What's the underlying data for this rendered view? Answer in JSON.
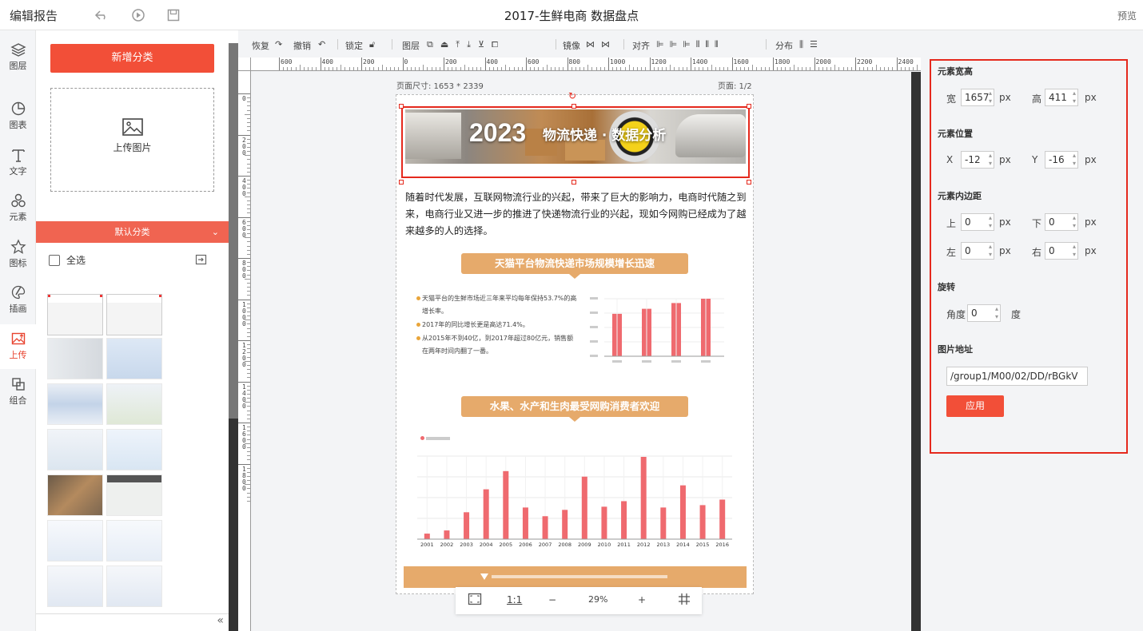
{
  "topbar": {
    "title": "编辑报告",
    "doc_title": "2017-生鲜电商 数据盘点",
    "preview": "预览"
  },
  "nav": [
    {
      "label": "图层",
      "icon": "layers-icon"
    },
    {
      "label": "图表",
      "icon": "chart-pie-icon"
    },
    {
      "label": "文字",
      "icon": "text-icon"
    },
    {
      "label": "元素",
      "icon": "shapes-icon"
    },
    {
      "label": "图标",
      "icon": "star-icon"
    },
    {
      "label": "插画",
      "icon": "palette-icon"
    },
    {
      "label": "上传",
      "icon": "upload-image-icon"
    },
    {
      "label": "组合",
      "icon": "combine-icon"
    }
  ],
  "left": {
    "add_category": "新增分类",
    "upload": "上传图片",
    "category": "默认分类",
    "select_all": "全选"
  },
  "toolbar": {
    "redo": "恢复",
    "undo": "撤销",
    "lock": "锁定",
    "layer": "图层",
    "mirror": "镜像",
    "align": "对齐",
    "distribute": "分布"
  },
  "ruler_h": [
    "600",
    "400",
    "200",
    "0",
    "200",
    "400",
    "600",
    "800",
    "1000",
    "1200",
    "1400",
    "1600",
    "1800",
    "2000",
    "2200",
    "2400"
  ],
  "ruler_v": [
    "0",
    "200",
    "400",
    "600",
    "800",
    "1000",
    "1200",
    "1400",
    "1600",
    "1800"
  ],
  "page": {
    "size": "页面尺寸: 1653 * 2339",
    "num": "页面: 1/2",
    "banner_year": "2023",
    "banner_title": "物流快递 · 数据分析",
    "intro": "随着时代发展，互联网物流行业的兴起，带来了巨大的影响力，电商时代随之到来，电商行业又进一步的推进了快递物流行业的兴起，现如今网购已经成为了越来越多的人的选择。",
    "section1": "天猫平台物流快递市场规模增长迅速",
    "section2": "水果、水产和生肉最受网购消费者欢迎",
    "bullets": [
      "天猫平台的生鲜市场近三年来平均每年保持53.7%的高增长率。",
      "2017年的同比增长更是高达71.4%。",
      "从2015年不到40亿，到2017年超过80亿元，销售额在两年时间内翻了一番。"
    ]
  },
  "zoom": {
    "ratio": "1:1",
    "minus": "−",
    "value": "29%",
    "plus": "+"
  },
  "props": {
    "size_title": "元素宽高",
    "w_label": "宽",
    "w": "1657",
    "h_label": "高",
    "h": "411",
    "pos_title": "元素位置",
    "x_label": "X",
    "x": "-12",
    "y_label": "Y",
    "y": "-16",
    "pad_title": "元素内边距",
    "top": "上",
    "top_v": "0",
    "bottom": "下",
    "bottom_v": "0",
    "left": "左",
    "left_v": "0",
    "right": "右",
    "right_v": "0",
    "rot_title": "旋转",
    "angle": "角度",
    "angle_v": "0",
    "deg": "度",
    "url_title": "图片地址",
    "url": "/group1/M00/02/DD/rBGkV",
    "apply": "应用",
    "px": "px"
  },
  "chart_data": [
    {
      "type": "bar",
      "values": [
        118,
        132,
        148,
        160
      ],
      "ylim": [
        0,
        160
      ],
      "color": "#ef6a6f"
    },
    {
      "type": "bar",
      "categories": [
        "2001",
        "2002",
        "2003",
        "2004",
        "2005",
        "2006",
        "2007",
        "2008",
        "2009",
        "2010",
        "2011",
        "2012",
        "2013",
        "2014",
        "2015",
        "2016"
      ],
      "values": [
        7,
        11,
        34,
        63,
        86,
        40,
        29,
        37,
        79,
        41,
        48,
        104,
        40,
        68,
        43,
        50
      ],
      "ylim": [
        0,
        105
      ],
      "color": "#ef6a6f"
    }
  ]
}
